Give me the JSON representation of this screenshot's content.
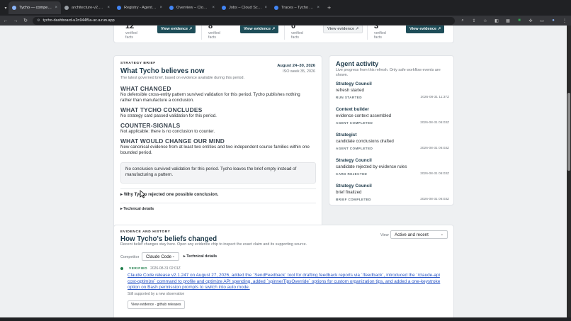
{
  "browser": {
    "tabs": [
      {
        "label": "Tycho — competitive-int",
        "active": true
      },
      {
        "label": "architecture-v2.png (36x",
        "active": false
      },
      {
        "label": "Registry - Agent Platform",
        "active": false
      },
      {
        "label": "Overview – Cloud Run –",
        "active": false
      },
      {
        "label": "Jobs – Cloud Scheduler –",
        "active": false
      },
      {
        "label": "Traces – Tycho – Google C",
        "active": false
      }
    ],
    "new_tab": "+",
    "url": "tycho-dashboard-u2n944f5a-uc.a.run.app"
  },
  "kpis": [
    {
      "value": "12",
      "label": "verified facts",
      "button": "View evidence ↗",
      "enabled": true
    },
    {
      "value": "8",
      "label": "verified facts",
      "button": "View evidence ↗",
      "enabled": true
    },
    {
      "value": "0",
      "label": "verified facts",
      "button": "View evidence ↗",
      "enabled": false
    },
    {
      "value": "3",
      "label": "verified facts",
      "button": "View evidence ↗",
      "enabled": true
    }
  ],
  "brief": {
    "eyebrow": "STRATEGY BRIEF",
    "title": "What Tycho believes now",
    "subtitle": "The latest governed brief, based on evidence available during this period.",
    "date": "August 24–30, 2026",
    "week": "ISO week 35, 2026",
    "sections": [
      {
        "heading": "WHAT CHANGED",
        "body": "No defensible cross-entity pattern survived validation for this period. Tycho publishes nothing rather than manufacture a conclusion."
      },
      {
        "heading": "WHAT TYCHO CONCLUDES",
        "body": "No strategy card passed validation for this period."
      },
      {
        "heading": "COUNTER-SIGNALS",
        "body": "Not applicable: there is no conclusion to counter."
      },
      {
        "heading": "WHAT WOULD CHANGE OUR MIND",
        "body": "New canonical evidence from at least two entities and two independent source families within one bounded period."
      }
    ],
    "notice": "No conclusion survived validation for this period. Tycho leaves the brief empty instead of manufacturing a pattern.",
    "disclosure": "▸ Why Tycho rejected one possible conclusion.",
    "technical": "▸ Technical details"
  },
  "activity": {
    "title": "Agent activity",
    "subtitle": "Live progress from this refresh. Only safe workflow events are shown.",
    "items": [
      {
        "agent": "Strategy Council",
        "desc": "refresh started",
        "status": "RUN STARTED",
        "time": "2026-08-31 11:37Z"
      },
      {
        "agent": "Context builder",
        "desc": "evidence context assembled",
        "status": "AGENT COMPLETED",
        "time": "2026-08-31 06:03Z"
      },
      {
        "agent": "Strategist",
        "desc": "candidate conclusions drafted",
        "status": "AGENT COMPLETED",
        "time": "2026-08-31 06:03Z"
      },
      {
        "agent": "Strategy Council",
        "desc": "candidate rejected by evidence rules",
        "status": "CARD REJECTED",
        "time": "2026-08-31 06:03Z"
      },
      {
        "agent": "Strategy Council",
        "desc": "brief finalized",
        "status": "BRIEF COMPLETED",
        "time": "2026-08-31 06:03Z"
      }
    ]
  },
  "history": {
    "eyebrow": "EVIDENCE AND HISTORY",
    "title": "How Tycho's beliefs changed",
    "subtitle": "Recent belief changes stay here. Open any evidence chip to inspect the exact claim and its supporting source.",
    "view_label": "View",
    "view_value": "Active and recent",
    "competitor_label": "Competitor",
    "competitor_value": "Claude Code",
    "technical": "▸ Technical details",
    "entry": {
      "badge": "VERIFIED",
      "time": "2026-08-31 02:01Z",
      "text": "Claude Code release v2.1.247 on August 27, 2026, added the `SendFeedback` tool for drafting feedback reports via `/feedback`, introduced the `/claude-api cost-optimize` command to profile and optimize API spending, added `spinnerTipsOverride` options for custom organization tips, and added a one-keystroke option on Bash permission prompts to switch into auto mode.",
      "note": "Still supported by a new observation",
      "chip": "View evidence · github releases"
    }
  },
  "colors": {
    "accent": "#1e4d58",
    "heading": "#1e3a4a",
    "link": "#2a56c6",
    "verified": "#1e7e4a"
  }
}
